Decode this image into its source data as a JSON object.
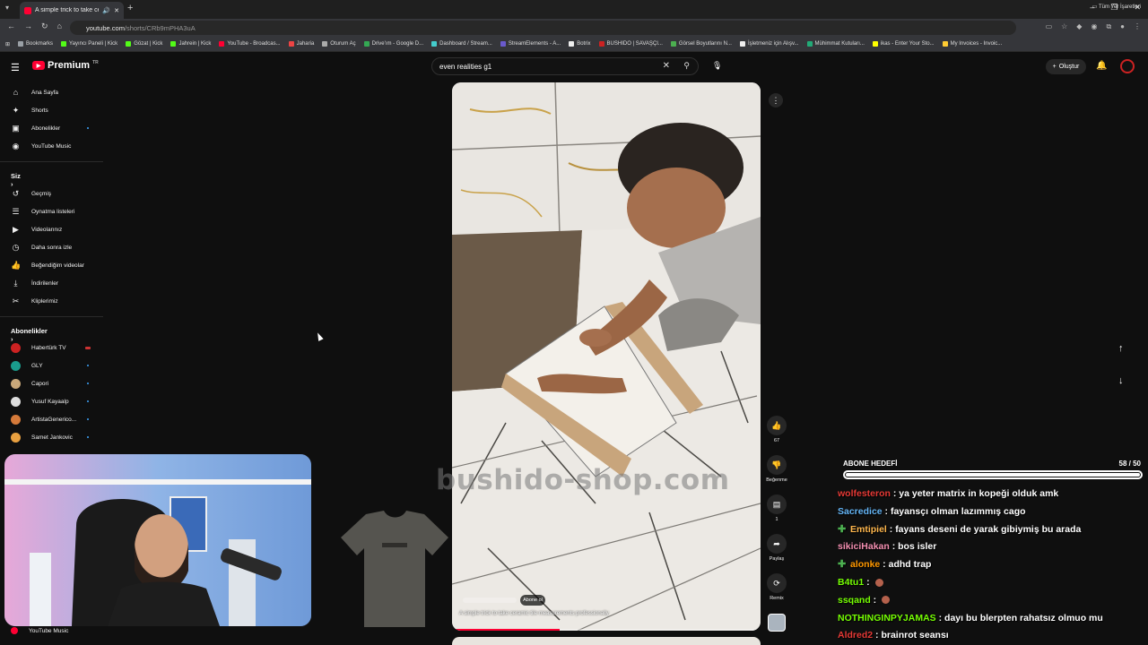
{
  "browser": {
    "tab_title": "A simple trick to take cerar",
    "url_host": "youtube.com",
    "url_path": "/shorts/CRb9mPHA3uA",
    "bookmarks": [
      {
        "label": "Bookmarks",
        "color": "#9aa0a6"
      },
      {
        "label": "Yayıncı Paneli | Kick",
        "color": "#53fc18"
      },
      {
        "label": "Gözat | Kick",
        "color": "#53fc18"
      },
      {
        "label": "Jahrein | Kick",
        "color": "#53fc18"
      },
      {
        "label": "YouTube - Broadcas...",
        "color": "#ff0033"
      },
      {
        "label": "Jaharia",
        "color": "#e44"
      },
      {
        "label": "Oturum Aç",
        "color": "#aaa"
      },
      {
        "label": "Drive'ım - Google D...",
        "color": "#34a853"
      },
      {
        "label": "Dashboard / Stream...",
        "color": "#4cc"
      },
      {
        "label": "StreamElements - A...",
        "color": "#6a5acd"
      },
      {
        "label": "Botrix",
        "color": "#eee"
      },
      {
        "label": "BUSHIDO | SAVAŞÇI...",
        "color": "#c22"
      },
      {
        "label": "Görsel Boyutlarını N...",
        "color": "#4caf50"
      },
      {
        "label": "İşletmeniz için Alışv...",
        "color": "#eee"
      },
      {
        "label": "Mühimmat Kutuları...",
        "color": "#2a7"
      },
      {
        "label": "ikas - Enter Your Sto...",
        "color": "#ff0"
      },
      {
        "label": "My Invoices - Invoic...",
        "color": "#fc3"
      }
    ],
    "all_bookmarks": "Tüm Yer İşaretleri"
  },
  "youtube": {
    "brand": "Premium",
    "brand_tr": "TR",
    "search_value": "even realities g1",
    "create_label": "Oluştur",
    "sidebar_main": [
      {
        "label": "Ana Sayfa",
        "icon": "home-icon",
        "glyph": "⌂"
      },
      {
        "label": "Shorts",
        "icon": "shorts-icon",
        "glyph": "✦"
      },
      {
        "label": "Abonelikler",
        "icon": "subscriptions-icon",
        "glyph": "▣"
      },
      {
        "label": "YouTube Music",
        "icon": "music-icon",
        "glyph": "◉"
      }
    ],
    "you_heading": "Siz",
    "sidebar_you": [
      {
        "label": "Geçmiş",
        "icon": "history-icon",
        "glyph": "↺"
      },
      {
        "label": "Oynatma listeleri",
        "icon": "playlists-icon",
        "glyph": "☰"
      },
      {
        "label": "Videolarınız",
        "icon": "your-videos-icon",
        "glyph": "▶"
      },
      {
        "label": "Daha sonra izle",
        "icon": "watch-later-icon",
        "glyph": "◷"
      },
      {
        "label": "Beğendiğim videolar",
        "icon": "liked-videos-icon",
        "glyph": "👍"
      },
      {
        "label": "İndirilenler",
        "icon": "downloads-icon",
        "glyph": "⤓"
      },
      {
        "label": "Kliplerimiz",
        "icon": "clips-icon",
        "glyph": "✂"
      }
    ],
    "subs_heading": "Abonelikler",
    "subscriptions": [
      {
        "label": "Habertürk TV",
        "color": "#c22"
      },
      {
        "label": "GLY",
        "color": "#1a9c8c"
      },
      {
        "label": "Capori",
        "color": "#c9a87a"
      },
      {
        "label": "Yusuf Kayaalp",
        "color": "#ddd"
      },
      {
        "label": "ArtistaGenerico...",
        "color": "#d57a3a"
      },
      {
        "label": "Samet Jankovic",
        "color": "#e8a040"
      }
    ],
    "footer_music": "YouTube Music",
    "short": {
      "caption": "A simple trick to take ceramic tile measurements professionally",
      "subscribe": "Abone ol",
      "progress": 0.35,
      "likes": "67",
      "dislike_label": "Beğenme",
      "comments": "1",
      "share_label": "Paylaş",
      "remix_label": "Remix"
    }
  },
  "overlay": {
    "watermark": "bushido-shop.com",
    "goal_title": "ABONE HEDEFİ",
    "goal_count": "58 / 50",
    "goal_fraction": 1.0,
    "chat": [
      {
        "user": "wolfesteron",
        "color": "#e53935",
        "text": "ya yeter matrix in kopeği olduk amk",
        "badge": false
      },
      {
        "user": "Sacredice",
        "color": "#64b5f6",
        "text": "fayansçı olman lazımmış cago",
        "badge": false
      },
      {
        "user": "Emtipiel",
        "color": "#ffb74d",
        "text": "fayans deseni de yarak gibiymiş bu arada",
        "badge": true
      },
      {
        "user": "sikiciHakan",
        "color": "#f48fb1",
        "text": "bos isler",
        "badge": false
      },
      {
        "user": "alonke",
        "color": "#ff9800",
        "text": "adhd trap",
        "badge": true
      },
      {
        "user": "B4tu1",
        "color": "#76ff03",
        "text": "",
        "badge": false,
        "emote": true
      },
      {
        "user": "ssqand",
        "color": "#76ff03",
        "text": "",
        "badge": false,
        "emote": true
      },
      {
        "user": "NOTHINGINPYJAMAS",
        "color": "#76ff03",
        "text": "dayı bu blerpten rahatsız olmuo mu",
        "badge": false
      },
      {
        "user": "Aldred2",
        "color": "#e53935",
        "text": "brainrot seansı",
        "badge": false
      }
    ]
  }
}
